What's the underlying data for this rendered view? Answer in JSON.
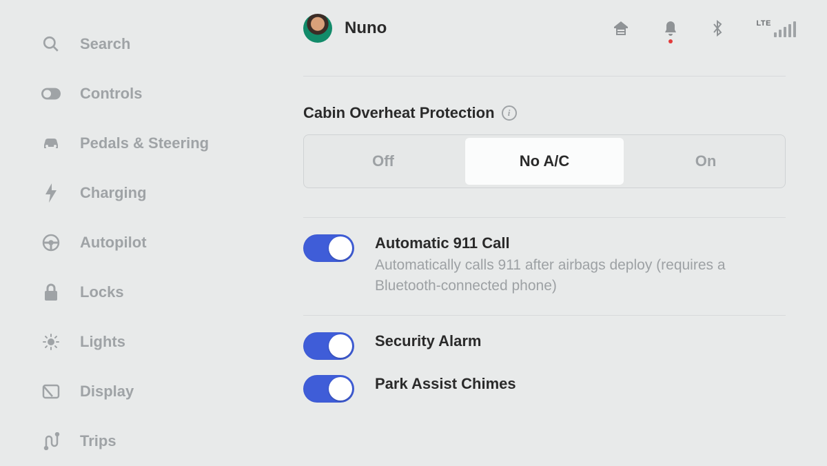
{
  "sidebar": {
    "items": [
      {
        "label": "Search",
        "icon": "search"
      },
      {
        "label": "Controls",
        "icon": "toggle"
      },
      {
        "label": "Pedals & Steering",
        "icon": "car"
      },
      {
        "label": "Charging",
        "icon": "bolt"
      },
      {
        "label": "Autopilot",
        "icon": "wheel"
      },
      {
        "label": "Locks",
        "icon": "lock"
      },
      {
        "label": "Lights",
        "icon": "sun"
      },
      {
        "label": "Display",
        "icon": "display"
      },
      {
        "label": "Trips",
        "icon": "route"
      }
    ]
  },
  "header": {
    "user": "Nuno",
    "network": "LTE",
    "notification_indicator": true
  },
  "settings": {
    "overheat": {
      "title": "Cabin Overheat Protection",
      "options": [
        "Off",
        "No A/C",
        "On"
      ],
      "selected": "No A/C"
    },
    "auto911": {
      "title": "Automatic 911 Call",
      "description": "Automatically calls 911 after airbags deploy (requires a Bluetooth-connected phone)",
      "enabled": true
    },
    "security_alarm": {
      "title": "Security Alarm",
      "enabled": true
    },
    "park_assist": {
      "title": "Park Assist Chimes",
      "enabled": true
    }
  },
  "colors": {
    "toggle_on": "#3f5dd8",
    "text_primary": "#2a2a2a",
    "text_muted": "#9fa3a6",
    "alert_dot": "#e23b3b"
  }
}
